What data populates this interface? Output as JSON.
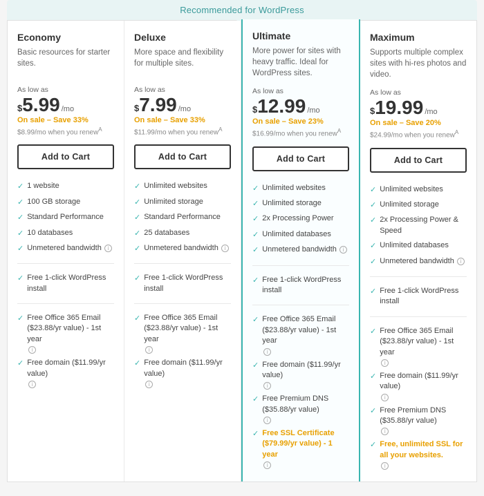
{
  "banner": {
    "text": "Recommended for WordPress"
  },
  "plans": [
    {
      "id": "economy",
      "name": "Economy",
      "description": "Basic resources for starter sites.",
      "price_label": "As low as",
      "price": "$5.99",
      "price_dollar": "$",
      "price_amount": "5.99",
      "price_suffix": "/mo",
      "sale": "On sale – Save 33%",
      "renew": "$8.99/mo when you renew",
      "button": "Add to Cart",
      "highlighted": false,
      "features": [
        {
          "text": "1 website",
          "highlight": false,
          "info": false
        },
        {
          "text": "100 GB storage",
          "highlight": false,
          "info": false
        },
        {
          "text": "Standard Performance",
          "highlight": false,
          "info": false
        },
        {
          "text": "10 databases",
          "highlight": false,
          "info": false
        },
        {
          "text": "Unmetered bandwidth",
          "highlight": false,
          "info": true
        }
      ],
      "extra_features": [
        {
          "text": "Free 1-click WordPress install",
          "highlight": false,
          "info": false
        }
      ],
      "bonus_features": [
        {
          "text": "Free Office 365 Email ($23.88/yr value) - 1st year",
          "highlight": false,
          "info": true
        },
        {
          "text": "Free domain ($11.99/yr value)",
          "highlight": false,
          "info": true
        }
      ]
    },
    {
      "id": "deluxe",
      "name": "Deluxe",
      "description": "More space and flexibility for multiple sites.",
      "price_label": "As low as",
      "price": "$7.99",
      "price_dollar": "$",
      "price_amount": "7.99",
      "price_suffix": "/mo",
      "sale": "On sale – Save 33%",
      "renew": "$11.99/mo when you renew",
      "button": "Add to Cart",
      "highlighted": false,
      "features": [
        {
          "text": "Unlimited websites",
          "highlight": false,
          "info": false
        },
        {
          "text": "Unlimited storage",
          "highlight": false,
          "info": false
        },
        {
          "text": "Standard Performance",
          "highlight": false,
          "info": false
        },
        {
          "text": "25 databases",
          "highlight": false,
          "info": false
        },
        {
          "text": "Unmetered bandwidth",
          "highlight": false,
          "info": true
        }
      ],
      "extra_features": [
        {
          "text": "Free 1-click WordPress install",
          "highlight": false,
          "info": false
        }
      ],
      "bonus_features": [
        {
          "text": "Free Office 365 Email ($23.88/yr value) - 1st year",
          "highlight": false,
          "info": true
        },
        {
          "text": "Free domain ($11.99/yr value)",
          "highlight": false,
          "info": true
        }
      ]
    },
    {
      "id": "ultimate",
      "name": "Ultimate",
      "description": "More power for sites with heavy traffic. Ideal for WordPress sites.",
      "price_label": "As low as",
      "price": "$12.99",
      "price_dollar": "$",
      "price_amount": "12.99",
      "price_suffix": "/mo",
      "sale": "On sale – Save 23%",
      "renew": "$16.99/mo when you renew",
      "button": "Add to Cart",
      "highlighted": true,
      "features": [
        {
          "text": "Unlimited websites",
          "highlight": false,
          "info": false
        },
        {
          "text": "Unlimited storage",
          "highlight": false,
          "info": false
        },
        {
          "text": "2x Processing Power",
          "highlight": false,
          "info": false
        },
        {
          "text": "Unlimited databases",
          "highlight": false,
          "info": false
        },
        {
          "text": "Unmetered bandwidth",
          "highlight": false,
          "info": true
        }
      ],
      "extra_features": [
        {
          "text": "Free 1-click WordPress install",
          "highlight": false,
          "info": false
        }
      ],
      "bonus_features": [
        {
          "text": "Free Office 365 Email ($23.88/yr value) - 1st year",
          "highlight": false,
          "info": true
        },
        {
          "text": "Free domain ($11.99/yr value)",
          "highlight": false,
          "info": true
        },
        {
          "text": "Free Premium DNS ($35.88/yr value)",
          "highlight": false,
          "info": true
        },
        {
          "text": "Free SSL Certificate ($79.99/yr value) - 1 year",
          "highlight": true,
          "info": true
        }
      ]
    },
    {
      "id": "maximum",
      "name": "Maximum",
      "description": "Supports multiple complex sites with hi-res photos and video.",
      "price_label": "As low as",
      "price": "$19.99",
      "price_dollar": "$",
      "price_amount": "19.99",
      "price_suffix": "/mo",
      "sale": "On sale – Save 20%",
      "renew": "$24.99/mo when you renew",
      "button": "Add to Cart",
      "highlighted": false,
      "features": [
        {
          "text": "Unlimited websites",
          "highlight": false,
          "info": false
        },
        {
          "text": "Unlimited storage",
          "highlight": false,
          "info": false
        },
        {
          "text": "2x Processing Power & Speed",
          "highlight": false,
          "info": false
        },
        {
          "text": "Unlimited databases",
          "highlight": false,
          "info": false
        },
        {
          "text": "Unmetered bandwidth",
          "highlight": false,
          "info": true
        }
      ],
      "extra_features": [
        {
          "text": "Free 1-click WordPress install",
          "highlight": false,
          "info": false
        }
      ],
      "bonus_features": [
        {
          "text": "Free Office 365 Email ($23.88/yr value) - 1st year",
          "highlight": false,
          "info": true
        },
        {
          "text": "Free domain ($11.99/yr value)",
          "highlight": false,
          "info": true
        },
        {
          "text": "Free Premium DNS ($35.88/yr value)",
          "highlight": false,
          "info": true
        },
        {
          "text": "Free, unlimited SSL for all your websites.",
          "highlight": true,
          "info": true
        }
      ]
    }
  ]
}
